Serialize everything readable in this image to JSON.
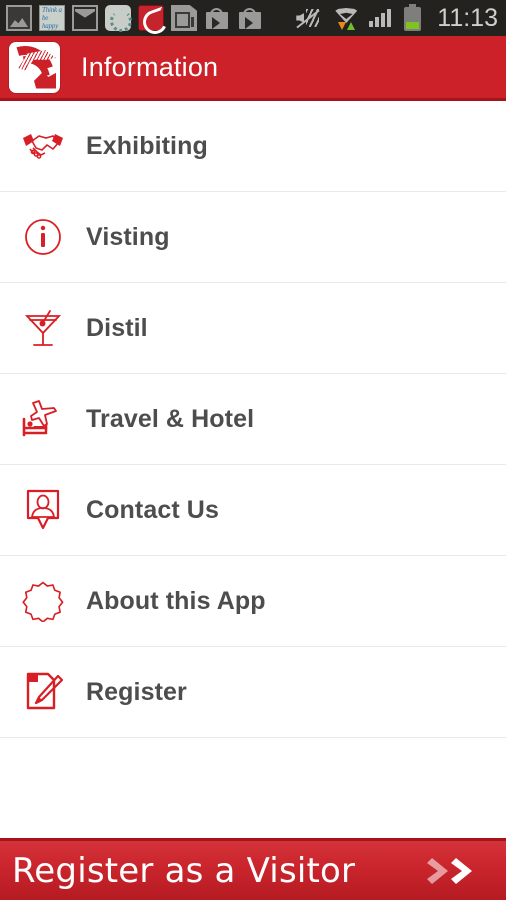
{
  "status_bar": {
    "time": "11:13",
    "left_icons": [
      {
        "name": "gallery-icon",
        "label": "Gallery"
      },
      {
        "name": "note-widget-icon",
        "label": "Think & be happy",
        "line1": "Think a",
        "line2": "be happy"
      },
      {
        "name": "gmail-icon",
        "label": "Gmail"
      },
      {
        "name": "sync-progress-icon",
        "label": "Sync"
      },
      {
        "name": "app-notification-icon",
        "label": "Event App"
      },
      {
        "name": "sd-card-icon",
        "label": "SD card"
      },
      {
        "name": "play-store-icon-1",
        "label": "Play Store"
      },
      {
        "name": "play-store-icon-2",
        "label": "Play Store"
      }
    ],
    "right_icons": [
      {
        "name": "mute-icon",
        "label": "Sound off / vibrate"
      },
      {
        "name": "wifi-icon",
        "label": "Wi-Fi with data transfer"
      },
      {
        "name": "signal-icon",
        "label": "Mobile signal",
        "bars": 4
      },
      {
        "name": "battery-icon",
        "label": "Battery",
        "level_pct": 30
      }
    ]
  },
  "header": {
    "title": "Information",
    "logo_name": "app-logo-icon",
    "background_color": "#CC2128",
    "text_color": "#FFFFFF"
  },
  "menu": {
    "items": [
      {
        "label": "Exhibiting",
        "icon": "handshake-icon"
      },
      {
        "label": "Visting",
        "icon": "info-circle-icon"
      },
      {
        "label": "Distil",
        "icon": "cocktail-glass-icon"
      },
      {
        "label": "Travel & Hotel",
        "icon": "plane-bed-icon"
      },
      {
        "label": "Contact Us",
        "icon": "contact-pin-icon"
      },
      {
        "label": "About this App",
        "icon": "starburst-badge-icon"
      },
      {
        "label": "Register",
        "icon": "document-pencil-icon"
      }
    ],
    "icon_color": "#D91F26",
    "label_color": "#4D4D4D"
  },
  "cta": {
    "label": "Register as a Visitor",
    "chevron_icon": "double-chevron-right-icon",
    "background_color": "#CB252D",
    "text_color": "#FFFFFF"
  }
}
